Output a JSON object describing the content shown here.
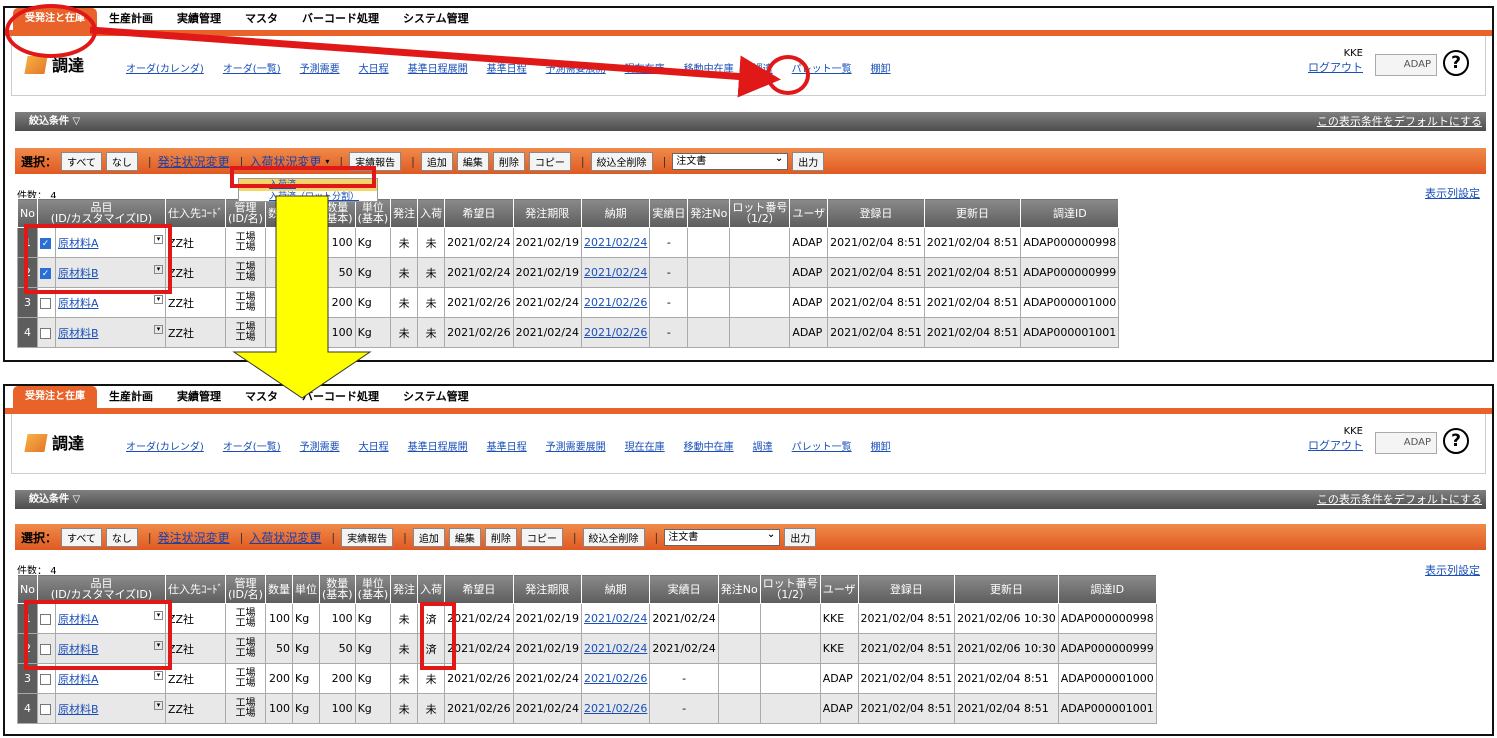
{
  "menu": {
    "tabs": [
      "受発注と在庫",
      "生産計画",
      "実績管理",
      "マスタ",
      "バーコード処理",
      "システム管理"
    ]
  },
  "page": {
    "title": "調達"
  },
  "nav": {
    "links": [
      "オーダ(カレンダ)",
      "オーダ(一覧)",
      "予測需要",
      "大日程",
      "基準日程展開",
      "基準日程",
      "予測需要展開",
      "現在在庫",
      "移動中在庫",
      "調達",
      "パレット一覧",
      "棚卸"
    ]
  },
  "user": {
    "name": "KKE",
    "logout": "ログアウト"
  },
  "logo": {
    "text": "ADAP"
  },
  "help": {
    "label": "?"
  },
  "filter": {
    "label": "絞込条件",
    "default_link": "この表示条件をデフォルトにする"
  },
  "toolbar": {
    "select_label": "選択：",
    "all": "すべて",
    "none": "なし",
    "order_status": "発注状況変更",
    "arrival_status": "入荷状況変更",
    "report": "実績報告",
    "add": "追加",
    "edit": "編集",
    "delete": "削除",
    "copy": "コピー",
    "clear_filter": "絞込全削除",
    "doc_select": "注文書",
    "output": "出力"
  },
  "dropdown": {
    "item1": "入荷済",
    "item2": "入荷済（ロット分割）"
  },
  "grid": {
    "count_label": "件数：",
    "count": "4",
    "col_settings": "表示列設定",
    "headers": {
      "no": "No",
      "item": "品目\n(ID/カスタマイズID)",
      "supplier": "仕入先ｺｰﾄﾞ",
      "mgmt": "管理\n(ID/名)",
      "qty": "数量",
      "unit": "単位",
      "qty_base": "数量\n(基本)",
      "unit_base": "単位\n(基本)",
      "order": "発注",
      "arrival": "入荷",
      "desired": "希望日",
      "order_deadline": "発注期限",
      "delivery": "納期",
      "actual": "実績日",
      "order_no": "発注No",
      "lot": "ロット番号\n（1/2）",
      "user": "ユーザ",
      "registered": "登録日",
      "updated": "更新日",
      "proc_id": "調達ID"
    }
  },
  "before": {
    "rows": [
      {
        "no": "1",
        "checked": true,
        "item": "原材料A",
        "supplier": "ZZ社",
        "mgmt": "工場\n工場",
        "qty_base": "100",
        "unit_base": "Kg",
        "order": "未",
        "arrival": "未",
        "desired": "2021/02/24",
        "deadline": "2021/02/19",
        "delivery": "2021/02/24",
        "actual": "-",
        "user": "ADAP",
        "registered": "2021/02/04 8:51",
        "updated": "2021/02/04 8:51",
        "id": "ADAP000000998"
      },
      {
        "no": "2",
        "checked": true,
        "item": "原材料B",
        "supplier": "ZZ社",
        "mgmt": "工場\n工場",
        "qty_base": "50",
        "unit_base": "Kg",
        "order": "未",
        "arrival": "未",
        "desired": "2021/02/24",
        "deadline": "2021/02/19",
        "delivery": "2021/02/24",
        "actual": "-",
        "user": "ADAP",
        "registered": "2021/02/04 8:51",
        "updated": "2021/02/04 8:51",
        "id": "ADAP000000999"
      },
      {
        "no": "3",
        "checked": false,
        "item": "原材料A",
        "supplier": "ZZ社",
        "mgmt": "工場\n工場",
        "qty_base": "200",
        "unit_base": "Kg",
        "order": "未",
        "arrival": "未",
        "desired": "2021/02/26",
        "deadline": "2021/02/24",
        "delivery": "2021/02/26",
        "actual": "-",
        "user": "ADAP",
        "registered": "2021/02/04 8:51",
        "updated": "2021/02/04 8:51",
        "id": "ADAP000001000"
      },
      {
        "no": "4",
        "checked": false,
        "item": "原材料B",
        "supplier": "ZZ社",
        "mgmt": "工場\n工場",
        "qty_base": "100",
        "unit_base": "Kg",
        "order": "未",
        "arrival": "未",
        "desired": "2021/02/26",
        "deadline": "2021/02/24",
        "delivery": "2021/02/26",
        "actual": "-",
        "user": "ADAP",
        "registered": "2021/02/04 8:51",
        "updated": "2021/02/04 8:51",
        "id": "ADAP000001001"
      }
    ]
  },
  "after": {
    "rows": [
      {
        "no": "1",
        "checked": false,
        "item": "原材料A",
        "supplier": "ZZ社",
        "mgmt": "工場\n工場",
        "qty": "100",
        "unit": "Kg",
        "qty_base": "100",
        "unit_base": "Kg",
        "order": "未",
        "arrival": "済",
        "desired": "2021/02/24",
        "deadline": "2021/02/19",
        "delivery": "2021/02/24",
        "actual": "2021/02/24",
        "user": "KKE",
        "registered": "2021/02/04 8:51",
        "updated": "2021/02/06 10:30",
        "id": "ADAP000000998"
      },
      {
        "no": "2",
        "checked": false,
        "item": "原材料B",
        "supplier": "ZZ社",
        "mgmt": "工場\n工場",
        "qty": "50",
        "unit": "Kg",
        "qty_base": "50",
        "unit_base": "Kg",
        "order": "未",
        "arrival": "済",
        "desired": "2021/02/24",
        "deadline": "2021/02/19",
        "delivery": "2021/02/24",
        "actual": "2021/02/24",
        "user": "KKE",
        "registered": "2021/02/04 8:51",
        "updated": "2021/02/06 10:30",
        "id": "ADAP000000999"
      },
      {
        "no": "3",
        "checked": false,
        "item": "原材料A",
        "supplier": "ZZ社",
        "mgmt": "工場\n工場",
        "qty": "200",
        "unit": "Kg",
        "qty_base": "200",
        "unit_base": "Kg",
        "order": "未",
        "arrival": "未",
        "desired": "2021/02/26",
        "deadline": "2021/02/24",
        "delivery": "2021/02/26",
        "actual": "-",
        "user": "ADAP",
        "registered": "2021/02/04 8:51",
        "updated": "2021/02/04 8:51",
        "id": "ADAP000001000"
      },
      {
        "no": "4",
        "checked": false,
        "item": "原材料B",
        "supplier": "ZZ社",
        "mgmt": "工場\n工場",
        "qty": "100",
        "unit": "Kg",
        "qty_base": "100",
        "unit_base": "Kg",
        "order": "未",
        "arrival": "未",
        "desired": "2021/02/26",
        "deadline": "2021/02/24",
        "delivery": "2021/02/26",
        "actual": "-",
        "user": "ADAP",
        "registered": "2021/02/04 8:51",
        "updated": "2021/02/04 8:51",
        "id": "ADAP000001001"
      }
    ]
  },
  "annotation_colors": {
    "highlight": "#e01818",
    "arrow": "#ffff00"
  }
}
